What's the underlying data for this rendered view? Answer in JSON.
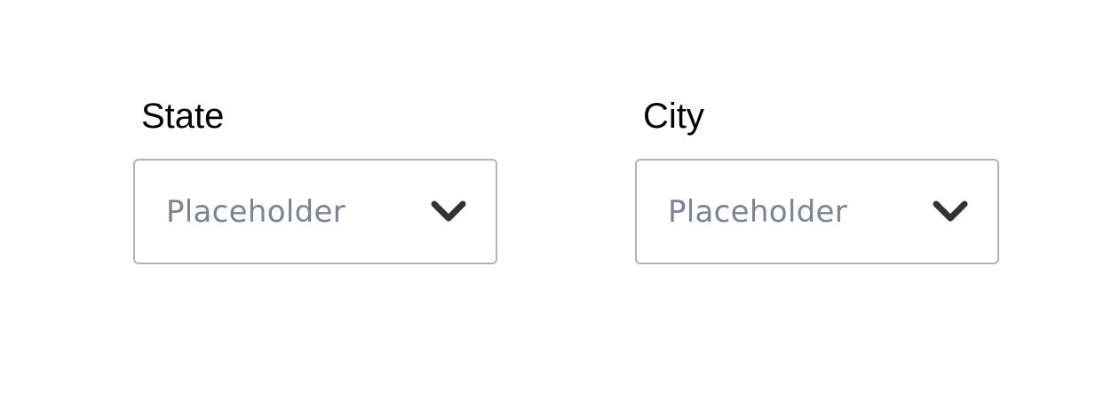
{
  "fields": {
    "state": {
      "label": "State",
      "placeholder": "Placeholder",
      "icon": "chevron-down-icon"
    },
    "city": {
      "label": "City",
      "placeholder": "Placeholder",
      "icon": "chevron-down-icon"
    }
  },
  "colors": {
    "label": "#000000",
    "placeholder": "#7c8393",
    "border": "#b3b3b5",
    "chevron": "#333333",
    "background": "#ffffff"
  }
}
